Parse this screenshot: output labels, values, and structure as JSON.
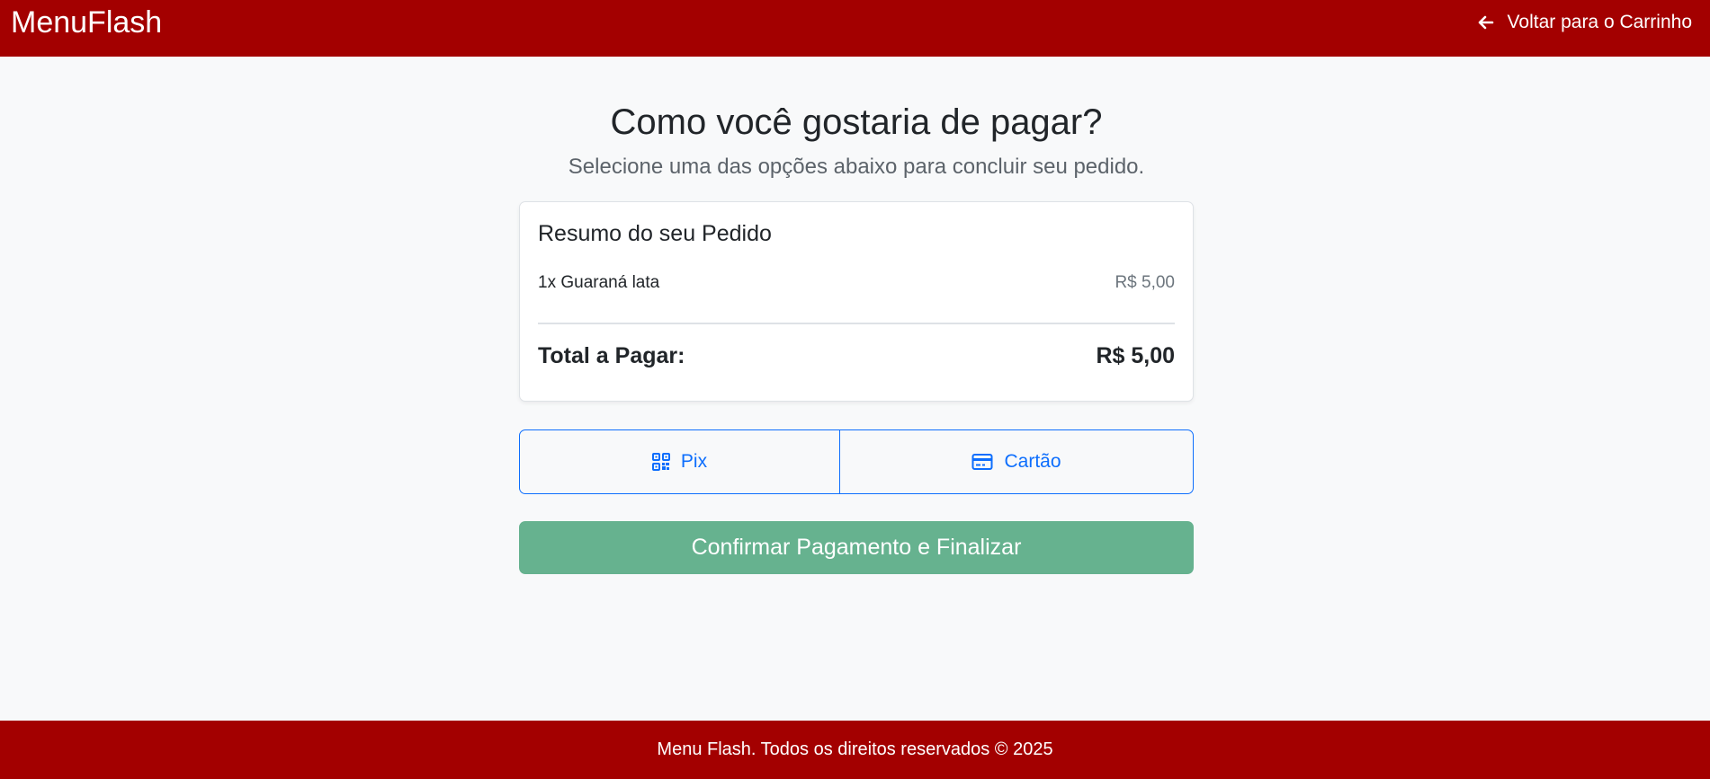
{
  "header": {
    "brand": "MenuFlash",
    "back_label": "Voltar para o Carrinho",
    "back_icon": "arrow-left-icon",
    "background": "#a30000"
  },
  "main": {
    "title": "Como você gostaria de pagar?",
    "subtitle": "Selecione uma das opções abaixo para concluir seu pedido."
  },
  "summary": {
    "title": "Resumo do seu Pedido",
    "items": [
      {
        "label": "1x Guaraná lata",
        "price": "R$ 5,00"
      }
    ],
    "total_label": "Total a Pagar:",
    "total_value": "R$ 5,00"
  },
  "payment": {
    "options": [
      {
        "label": "Pix",
        "icon": "qr-code-icon"
      },
      {
        "label": "Cartão",
        "icon": "credit-card-icon"
      }
    ],
    "accent": "#0d6efd"
  },
  "confirm": {
    "label": "Confirmar Pagamento e Finalizar",
    "color": "#66b28f"
  },
  "footer": {
    "text": "Menu Flash. Todos os direitos reservados © 2025"
  }
}
